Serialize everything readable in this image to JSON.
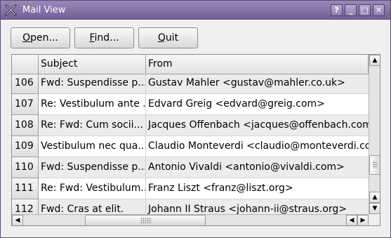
{
  "window": {
    "title": "Mail View",
    "controls": {
      "help": "?",
      "minimize": "_",
      "maximize": "□",
      "close": "✕"
    }
  },
  "toolbar": {
    "open": {
      "mnemonic": "O",
      "rest": "pen..."
    },
    "find": {
      "mnemonic": "F",
      "rest": "ind..."
    },
    "quit": {
      "mnemonic": "Q",
      "rest": "uit"
    }
  },
  "table": {
    "columns": [
      "Subject",
      "From"
    ],
    "rows": [
      {
        "num": "106",
        "subject": "Fwd: Suspendisse p...",
        "from": "Gustav Mahler <gustav@mahler.co.uk>"
      },
      {
        "num": "107",
        "subject": "Re: Vestibulum ante ...",
        "from": "Edvard Greig <edvard@greig.com>"
      },
      {
        "num": "108",
        "subject": "Re: Fwd: Cum socii...",
        "from": "Jacques Offenbach <jacques@offenbach.com>"
      },
      {
        "num": "109",
        "subject": "Vestibulum nec qua...",
        "from": "Claudio Monteverdi <claudio@monteverdi.co..."
      },
      {
        "num": "110",
        "subject": "Fwd: Suspendisse p...",
        "from": "Antonio Vivaldi <antonio@vivaldi.com>"
      },
      {
        "num": "111",
        "subject": "Re: Fwd: Vestibulum...",
        "from": "Franz Liszt <franz@liszt.org>"
      },
      {
        "num": "112",
        "subject": "Fwd: Cras at elit.",
        "from": "Johann II Straus <johann-ii@straus.org>"
      }
    ]
  },
  "scrollbars": {
    "vertical_position": 0.82,
    "horizontal_position": 0.0
  },
  "colors": {
    "titlebar": "#8a76aa",
    "row_alt": "#ececec",
    "row_plain": "#ffffff"
  }
}
